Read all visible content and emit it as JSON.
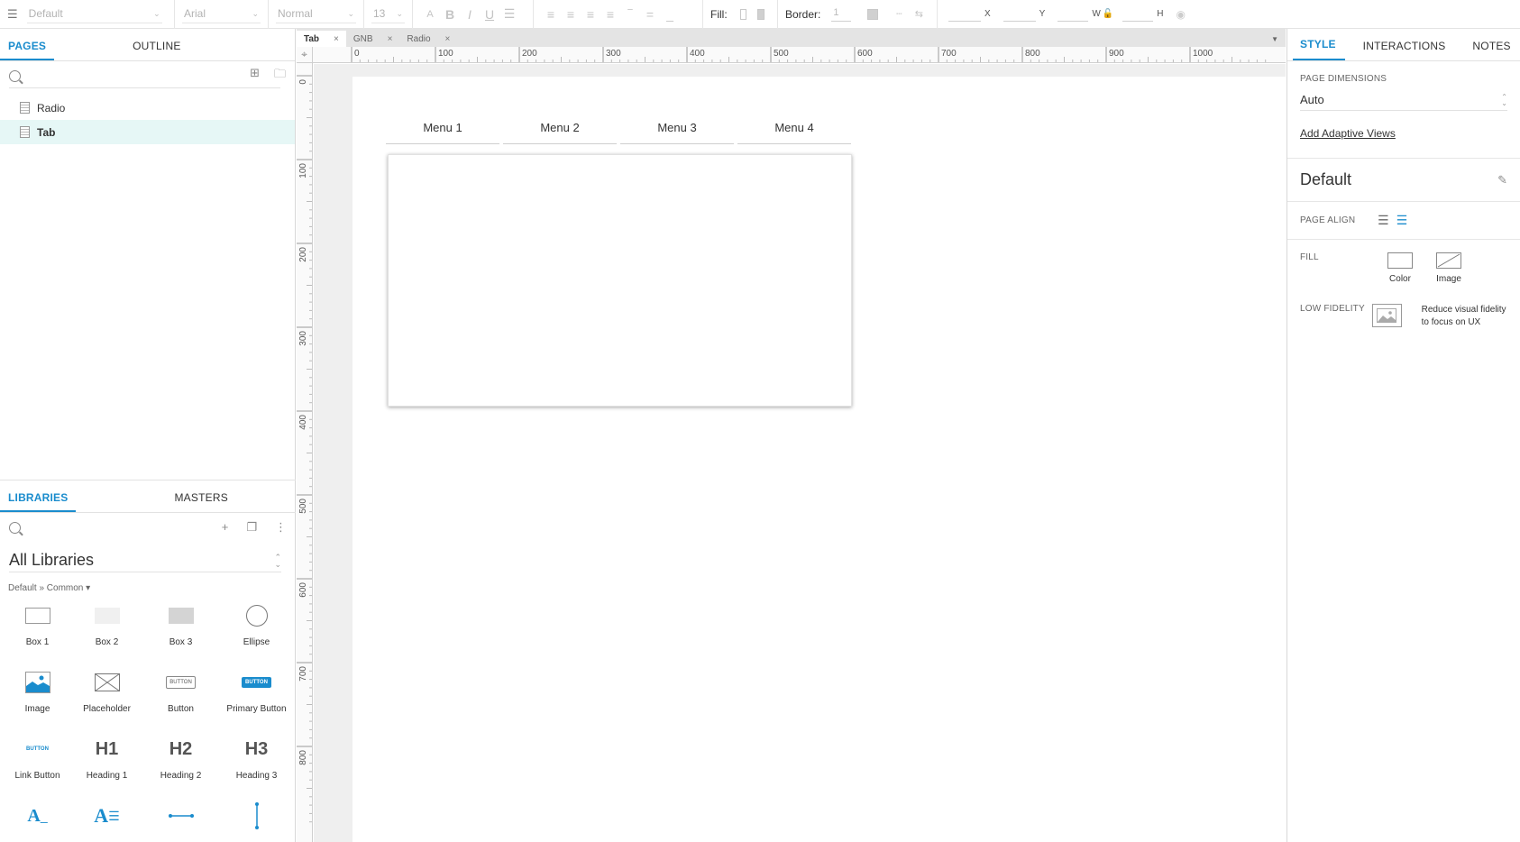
{
  "toolbar": {
    "style_select": "Default",
    "font_select": "Arial",
    "weight_select": "Normal",
    "size_select": "13",
    "fill_label": "Fill:",
    "border_label": "Border:",
    "border_value": "1",
    "x_label": "X",
    "y_label": "Y",
    "w_label": "W",
    "h_label": "H"
  },
  "pages_panel": {
    "tabs": [
      "PAGES",
      "OUTLINE"
    ],
    "pages": [
      {
        "label": "Radio"
      },
      {
        "label": "Tab"
      }
    ]
  },
  "libraries_panel": {
    "tabs": [
      "LIBRARIES",
      "MASTERS"
    ],
    "library_select": "All Libraries",
    "breadcrumb": "Default » Common ▾",
    "items": [
      {
        "label": "Box 1"
      },
      {
        "label": "Box 2"
      },
      {
        "label": "Box 3"
      },
      {
        "label": "Ellipse"
      },
      {
        "label": "Image"
      },
      {
        "label": "Placeholder"
      },
      {
        "label": "Button"
      },
      {
        "label": "Primary Button"
      },
      {
        "label": "Link Button"
      },
      {
        "label": "Heading 1"
      },
      {
        "label": "Heading 2"
      },
      {
        "label": "Heading 3"
      }
    ],
    "thumb_text": {
      "button": "BUTTON",
      "primary_button": "BUTTON",
      "link_button": "BUTTON",
      "h1": "H1",
      "h2": "H2",
      "h3": "H3"
    }
  },
  "document_tabs": [
    {
      "label": "Tab"
    },
    {
      "label": "GNB"
    },
    {
      "label": "Radio"
    }
  ],
  "rulers": {
    "top_ticks": [
      "0",
      "100",
      "200",
      "300",
      "400",
      "500",
      "600",
      "700",
      "800",
      "900",
      "1000"
    ],
    "left_ticks": [
      "0",
      "100",
      "200",
      "300",
      "400",
      "500",
      "600",
      "700",
      "800"
    ]
  },
  "canvas": {
    "menu_tabs": [
      "Menu 1",
      "Menu 2",
      "Menu 3",
      "Menu 4"
    ]
  },
  "style_panel": {
    "tabs": [
      "STYLE",
      "INTERACTIONS",
      "NOTES"
    ],
    "page_dimensions_label": "PAGE DIMENSIONS",
    "page_dimensions_value": "Auto",
    "adaptive_views_link": "Add Adaptive Views",
    "style_title": "Default",
    "page_align_label": "PAGE ALIGN",
    "fill_label": "FILL",
    "fill_options": [
      "Color",
      "Image"
    ],
    "low_fidelity_label": "LOW FIDELITY",
    "low_fidelity_desc": "Reduce visual fidelity to focus on UX"
  },
  "colors": {
    "accent": "#1a8ccd",
    "selected_page_bg": "#e6f7f6",
    "canvas_bg": "#efefef"
  }
}
